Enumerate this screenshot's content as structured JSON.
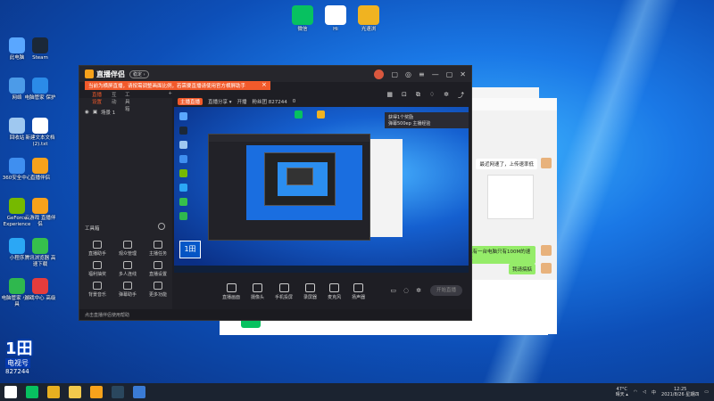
{
  "desktop": {
    "top_icons": [
      {
        "label": "微信",
        "icon": "wechat-icon",
        "color": "#07c160"
      },
      {
        "label": "Hi",
        "icon": "star-icon",
        "color": "#ffffff"
      },
      {
        "label": "光速浏",
        "icon": "app-icon",
        "color": "#f0b321"
      }
    ],
    "left_icons": [
      {
        "label": "此电脑",
        "icon": "computer-icon",
        "color": "#5aa7ff"
      },
      {
        "label": "Steam",
        "icon": "steam-icon",
        "color": "#1b2838"
      },
      {
        "label": "网络",
        "icon": "network-icon",
        "color": "#4c9be8"
      },
      {
        "label": "电脑管家 保护",
        "icon": "shield-icon",
        "color": "#2b8be8"
      },
      {
        "label": "回收站",
        "icon": "recycle-bin-icon",
        "color": "#9fc8f0"
      },
      {
        "label": "新建文本文档 (2).txt",
        "icon": "document-icon",
        "color": "#ffffff"
      },
      {
        "label": "360安全中心",
        "icon": "security-icon",
        "color": "#3f8ff0"
      },
      {
        "label": "直播伴侣",
        "icon": "live-companion-icon",
        "color": "#f7a21b"
      },
      {
        "label": "GeForce Experience",
        "icon": "nvidia-icon",
        "color": "#76b900"
      },
      {
        "label": "云游戏 直播伴侣",
        "icon": "live-companion-icon",
        "color": "#f7a21b"
      },
      {
        "label": "小程序",
        "icon": "miniapp-icon",
        "color": "#2ba7f5"
      },
      {
        "label": "腾讯浏览器 高速下载",
        "icon": "browser-icon",
        "color": "#36c04c"
      },
      {
        "label": "电脑管家 小工具",
        "icon": "plus-icon",
        "color": "#2fb84e"
      },
      {
        "label": "游戏中心 高级",
        "icon": "game-icon",
        "color": "#e53c3c"
      }
    ]
  },
  "watermark": {
    "big": "1田",
    "sub": "电视号",
    "id": "827244"
  },
  "live_app": {
    "name": "直播伴侣",
    "version_badge": "稳定 ›",
    "notice": "当前为横屏直播，请按需调整画面比例，若需要直播请使用官方横屏助手",
    "notice_close": "×",
    "tabs": [
      "直播设置",
      "互动",
      "工具箱"
    ],
    "tab_add": "+",
    "scene_label": "场景 1",
    "tools_title": "工具箱",
    "tools": [
      {
        "label": "直播助手",
        "icon": "assistant-icon"
      },
      {
        "label": "观众管理",
        "icon": "audience-icon"
      },
      {
        "label": "主播任务",
        "icon": "task-icon"
      },
      {
        "label": "福利抽奖",
        "icon": "lottery-icon"
      },
      {
        "label": "多人连线",
        "icon": "multiplayer-icon"
      },
      {
        "label": "直播设置",
        "icon": "settings-icon"
      },
      {
        "label": "背景音乐",
        "icon": "music-icon"
      },
      {
        "label": "弹幕助手",
        "icon": "danmaku-icon"
      },
      {
        "label": "更多功能",
        "icon": "more-icon"
      }
    ],
    "footer": "点击直播伴侣使用帮助",
    "info_badge": "主播直播",
    "info_items": [
      "直播分享 ▾",
      "开播",
      "粉丝团 827244",
      "0"
    ],
    "preview_panel_title": "获得1个奖励",
    "preview_panel_sub": "弹幕500ep 主播经验",
    "preview_watermark": "1田",
    "controls": [
      {
        "label": "直播画面",
        "icon": "screen-icon"
      },
      {
        "label": "摄像头",
        "icon": "camera-icon"
      },
      {
        "label": "手机投屏",
        "icon": "phone-icon"
      },
      {
        "label": "录屏器",
        "icon": "recorder-icon"
      },
      {
        "label": "麦克风",
        "icon": "mic-icon"
      },
      {
        "label": "扬声器",
        "icon": "speaker-icon"
      }
    ],
    "go_live": "开始直播",
    "accent": "#f25a2b"
  },
  "wechat": {
    "bubbles": [
      "最近网速了，上传速率低",
      "我有一台电脑只有100M的速率",
      "我请搞掂"
    ]
  },
  "taskbar": {
    "apps": [
      {
        "icon": "windows-start-icon",
        "color": "#ffffff"
      },
      {
        "icon": "wechat-icon",
        "color": "#07c160"
      },
      {
        "icon": "chrome-icon",
        "color": "#e8b020"
      },
      {
        "icon": "folder-icon",
        "color": "#f2c94c"
      },
      {
        "icon": "live-companion-icon",
        "color": "#f7a21b"
      },
      {
        "icon": "steam-icon",
        "color": "#2a475e"
      },
      {
        "icon": "terminal-icon",
        "color": "#3a7bd5"
      }
    ],
    "weather_temp": "47°C",
    "weather_desc": "晴天 ▴",
    "time": "12:25",
    "date": "2021/8/26 星期四"
  }
}
